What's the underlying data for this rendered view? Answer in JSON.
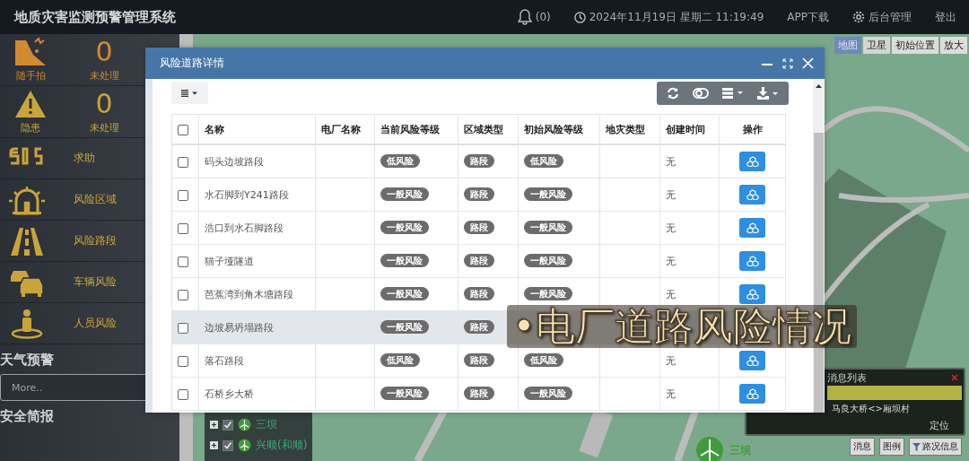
{
  "header": {
    "title": "地质灾害监测预警管理系统",
    "notifications": "(0)",
    "datetime": "2024年11月19日 星期二 11:19:49",
    "links": [
      {
        "kind": "app",
        "label": "APP下载"
      },
      {
        "kind": "admin",
        "label": "后台管理"
      },
      {
        "kind": "logout",
        "label": "登出"
      }
    ]
  },
  "sidebar": {
    "items": [
      {
        "kind": "counter",
        "label": "随手拍",
        "count": "0",
        "count_label": "未处理",
        "color": "#d08a30"
      },
      {
        "kind": "counter",
        "label": "隐患",
        "count": "0",
        "count_label": "未处理",
        "color": "#c9a43a"
      },
      {
        "kind": "link",
        "label": "求助"
      },
      {
        "kind": "link",
        "label": "风险区域"
      },
      {
        "kind": "link",
        "label": "风险路段"
      },
      {
        "kind": "link",
        "label": "车辆风险"
      },
      {
        "kind": "link",
        "label": "人员风险"
      }
    ],
    "weather": {
      "title": "天气预警",
      "field": {
        "placeholder": "More.."
      }
    },
    "briefing": {
      "title": "安全简报"
    }
  },
  "map": {
    "view_modes": [
      {
        "label": "地图",
        "selected": true
      },
      {
        "label": "卫星",
        "selected": false
      }
    ],
    "controls": [
      "初始位置",
      "放大"
    ],
    "tree": [
      {
        "label": "三坝",
        "checked": true
      },
      {
        "label": "兴顺(和顺)",
        "checked": true
      }
    ],
    "place_label": "三坝",
    "messages": {
      "title": "消息列表",
      "text": "马良大桥<>厢坝村",
      "locate": "定位"
    },
    "bottom_buttons": [
      {
        "kind": "plain",
        "label": "消息"
      },
      {
        "kind": "plain",
        "label": "图例"
      },
      {
        "kind": "filter",
        "label": "路况信息"
      }
    ]
  },
  "modal": {
    "title": "风险道路详情",
    "select_all_checked": false,
    "columns": [
      "名称",
      "电厂名称",
      "当前风险等级",
      "区域类型",
      "初始风险等级",
      "地灾类型",
      "创建时间",
      "操作"
    ],
    "rows": [
      {
        "name": "码头边坡路段",
        "current_risk": "低风险",
        "area_type": "路段",
        "initial_risk": "低风险",
        "created": "无",
        "checked": false,
        "highlighted": false
      },
      {
        "name": "水石脚到Y241路段",
        "current_risk": "一般风险",
        "area_type": "路段",
        "initial_risk": "一般风险",
        "created": "无",
        "checked": false,
        "highlighted": false
      },
      {
        "name": "浩口到水石脚路段",
        "current_risk": "一般风险",
        "area_type": "路段",
        "initial_risk": "一般风险",
        "created": "无",
        "checked": false,
        "highlighted": false
      },
      {
        "name": "猫子垭隧道",
        "current_risk": "一般风险",
        "area_type": "路段",
        "initial_risk": "一般风险",
        "created": "无",
        "checked": false,
        "highlighted": false
      },
      {
        "name": "芭蕉湾到角木塘路段",
        "current_risk": "一般风险",
        "area_type": "路段",
        "initial_risk": "一般风险",
        "created": "无",
        "checked": false,
        "highlighted": false
      },
      {
        "name": "边坡易坍塌路段",
        "current_risk": "一般风险",
        "area_type": "路段",
        "checked": false,
        "highlighted": true
      },
      {
        "name": "落石路段",
        "current_risk": "低风险",
        "area_type": "路段",
        "initial_risk": "低风险",
        "created": "无",
        "checked": false,
        "highlighted": false
      },
      {
        "name": "石桥乡大桥",
        "current_risk": "一般风险",
        "area_type": "路段",
        "initial_risk": "一般风险",
        "created": "无",
        "checked": false,
        "highlighted": false
      }
    ]
  },
  "caption": "•电厂道路风险情况"
}
